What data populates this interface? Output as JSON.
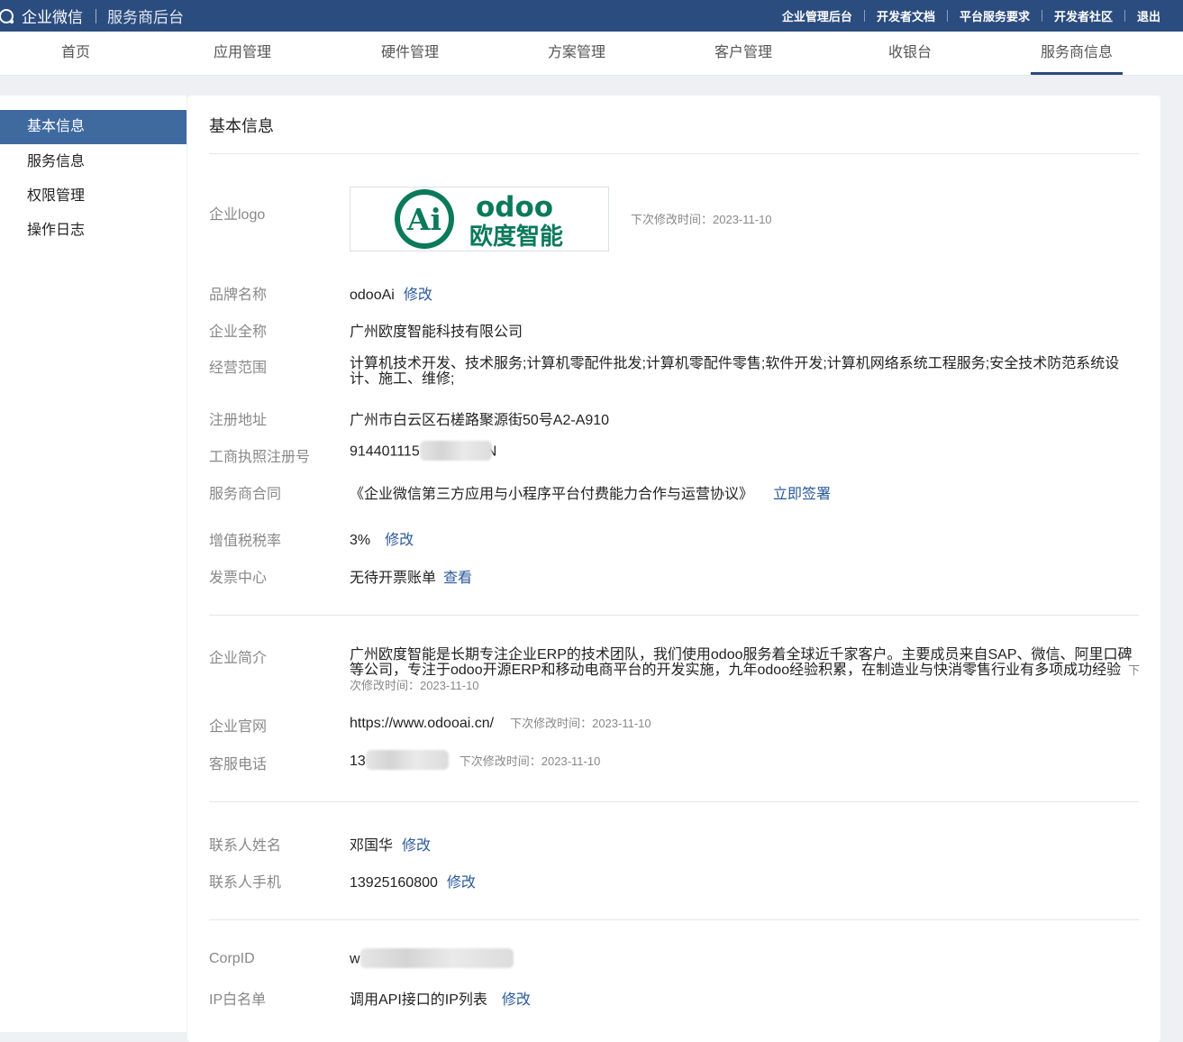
{
  "topbar": {
    "app_name": "企业微信",
    "subtitle": "服务商后台",
    "links": [
      "企业管理后台",
      "开发者文档",
      "平台服务要求",
      "开发者社区",
      "退出"
    ]
  },
  "nav": {
    "tabs": [
      "首页",
      "应用管理",
      "硬件管理",
      "方案管理",
      "客户管理",
      "收银台",
      "服务商信息"
    ],
    "active": "服务商信息"
  },
  "sidebar": {
    "items": [
      "基本信息",
      "服务信息",
      "权限管理",
      "操作日志"
    ],
    "active": "基本信息"
  },
  "main": {
    "title": "基本信息",
    "logo": {
      "label": "企业logo",
      "logo_text_top": "odoo",
      "logo_text_bottom": "欧度智能",
      "logo_badge": "Ai",
      "hint": "下次修改时间：2023-11-10"
    },
    "brand": {
      "label": "品牌名称",
      "value": "odooAi",
      "action": "修改"
    },
    "fullname": {
      "label": "企业全称",
      "value": "广州欧度智能科技有限公司"
    },
    "scope": {
      "label": "经营范围",
      "value": "计算机技术开发、技术服务;计算机零配件批发;计算机零配件零售;软件开发;计算机网络系统工程服务;安全技术防范系统设计、施工、维修;"
    },
    "address": {
      "label": "注册地址",
      "value": "广州市白云区石槎路聚源街50号A2-A910"
    },
    "license": {
      "label": "工商执照注册号",
      "value_prefix": "914401115",
      "value_suffix": "N"
    },
    "contract": {
      "label": "服务商合同",
      "value": "《企业微信第三方应用与小程序平台付费能力合作与运营协议》",
      "action": "立即签署"
    },
    "tax": {
      "label": "增值税税率",
      "value": "3%",
      "action": "修改"
    },
    "invoice": {
      "label": "发票中心",
      "value": "无待开票账单",
      "action": "查看"
    },
    "intro": {
      "label": "企业简介",
      "value": "广州欧度智能是长期专注企业ERP的技术团队，我们使用odoo服务着全球近千家客户。主要成员来自SAP、微信、阿里口碑等公司，专注于odoo开源ERP和移动电商平台的开发实施，九年odoo经验积累，在制造业与快消零售行业有多项成功经验",
      "hint": "下次修改时间：2023-11-10"
    },
    "website": {
      "label": "企业官网",
      "value": "https://www.odooai.cn/",
      "hint": "下次修改时间：2023-11-10"
    },
    "phone": {
      "label": "客服电话",
      "value_prefix": "13",
      "hint": "下次修改时间：2023-11-10"
    },
    "contact_name": {
      "label": "联系人姓名",
      "value": "邓国华",
      "action": "修改"
    },
    "contact_phone": {
      "label": "联系人手机",
      "value": "13925160800",
      "action": "修改"
    },
    "corpid": {
      "label": "CorpID",
      "value_prefix": "w"
    },
    "ip": {
      "label": "IP白名单",
      "value": "调用API接口的IP列表",
      "action": "修改"
    }
  },
  "colors": {
    "topbar": "#2b4c7e",
    "accent": "#2b5a9a",
    "logo_green": "#0b7a5a"
  }
}
